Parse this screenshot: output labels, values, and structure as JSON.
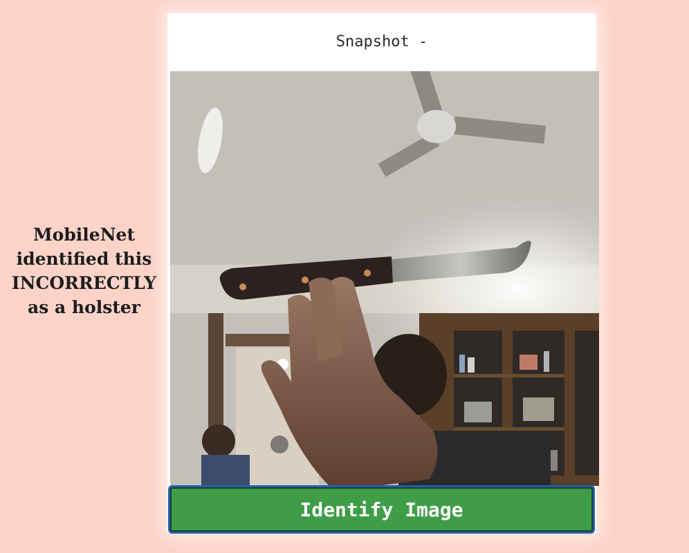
{
  "result": {
    "lines": [
      "MobileNet",
      "identified this",
      "INCORRECTLY",
      "as a holster"
    ]
  },
  "card": {
    "title": "Snapshot -"
  },
  "identify_button": {
    "label": "Identify Image"
  },
  "colors": {
    "page_background": "#fdd3c8",
    "button_background": "#3f9d48",
    "button_border": "#1f5fae"
  }
}
